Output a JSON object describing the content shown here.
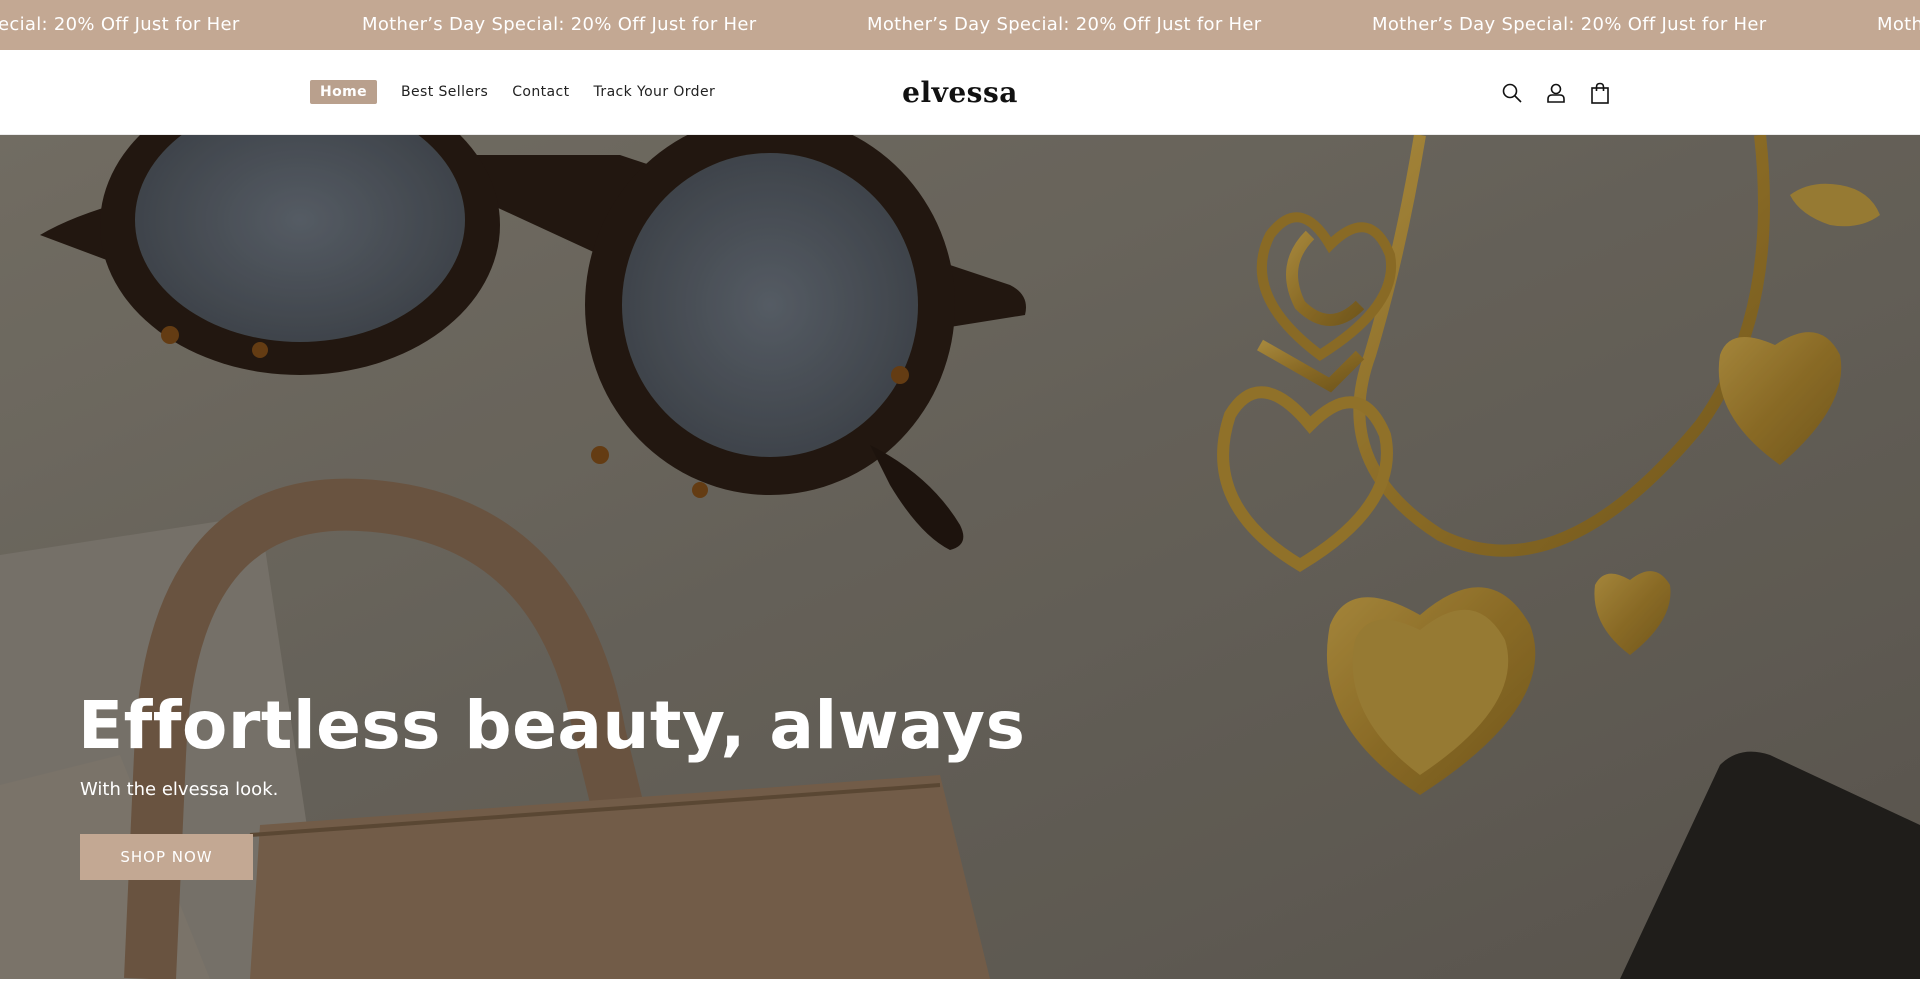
{
  "announcement": {
    "messages": [
      "ecial: 20% Off Just for Her",
      "Mother’s Day Special: 20% Off Just for Her",
      "Mother’s Day Special: 20% Off Just for Her",
      "Mother’s Day Special: 20% Off Just for Her",
      "Moth"
    ],
    "color": "#c3a893"
  },
  "header": {
    "nav": [
      "Home",
      "Best Sellers",
      "Contact",
      "Track Your Order"
    ],
    "active_nav": "Home",
    "logo": "elvessa",
    "icons": [
      "search-icon",
      "account-icon",
      "cart-icon"
    ]
  },
  "hero": {
    "title": "Effortless beauty, always",
    "subtitle": "With the elvessa look.",
    "button": "SHOP NOW",
    "accent": "#c3a893"
  }
}
